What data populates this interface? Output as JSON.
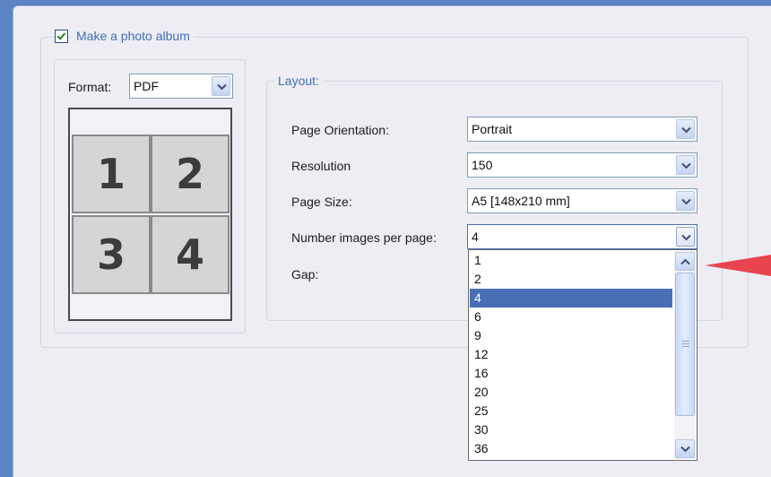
{
  "album": {
    "checkbox_label": "Make a photo album",
    "checked": true
  },
  "format": {
    "label": "Format:",
    "value": "PDF",
    "preview_cells": [
      "1",
      "2",
      "3",
      "4"
    ]
  },
  "layout": {
    "legend": "Layout:",
    "fields": [
      {
        "label": "Page Orientation:",
        "value": "Portrait"
      },
      {
        "label": "Resolution",
        "value": "150"
      },
      {
        "label": "Page Size:",
        "value": "A5 [148x210 mm]"
      },
      {
        "label": "Number images per page:",
        "value": "4"
      }
    ],
    "gap_label": "Gap:"
  },
  "images_per_page_dropdown": {
    "options": [
      "1",
      "2",
      "4",
      "6",
      "9",
      "12",
      "16",
      "20",
      "25",
      "30",
      "36"
    ],
    "selected": "4"
  },
  "colors": {
    "accent": "#3f6fb5",
    "selection": "#4a6eb3",
    "pointer_arrow": "#e8444f"
  }
}
